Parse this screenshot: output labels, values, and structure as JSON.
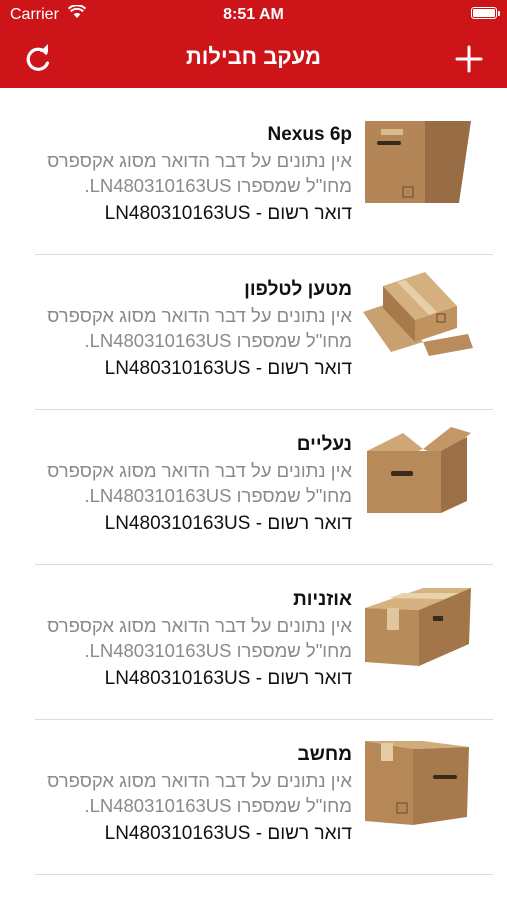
{
  "status_bar": {
    "carrier": "Carrier",
    "time": "8:51 AM"
  },
  "nav": {
    "title": "מעקב חבילות",
    "refresh_icon": "refresh-icon",
    "add_icon": "plus-icon"
  },
  "colors": {
    "header": "#cd1419",
    "box": "#b98b5e",
    "box_dark": "#8d6844",
    "description": "#8a8a8a"
  },
  "packages": [
    {
      "title": "Nexus 6p",
      "description": "אין נתונים על דבר הדואר מסוג אקספרס מחו\"ל שמספרו LN480310163US.",
      "tracking": "דואר רשום - LN480310163US",
      "image": "closed-box-front-icon"
    },
    {
      "title": "מטען לטלפון",
      "description": "אין נתונים על דבר הדואר מסוג אקספרס מחו\"ל שמספרו LN480310163US.",
      "tracking": "דואר רשום - LN480310163US",
      "image": "open-flaps-box-icon"
    },
    {
      "title": "נעליים",
      "description": "אין נתונים על דבר הדואר מסוג אקספרס מחו\"ל שמספרו LN480310163US.",
      "tracking": "דואר רשום - LN480310163US",
      "image": "open-top-box-icon"
    },
    {
      "title": "אוזניות",
      "description": "אין נתונים על דבר הדואר מסוג אקספרס מחו\"ל שמספרו LN480310163US.",
      "tracking": "דואר רשום - LN480310163US",
      "image": "taped-box-icon"
    },
    {
      "title": "מחשב",
      "description": "אין נתונים על דבר הדואר מסוג אקספרס מחו\"ל שמספרו LN480310163US.",
      "tracking": "דואר רשום - LN480310163US",
      "image": "closed-box-side-icon"
    }
  ]
}
